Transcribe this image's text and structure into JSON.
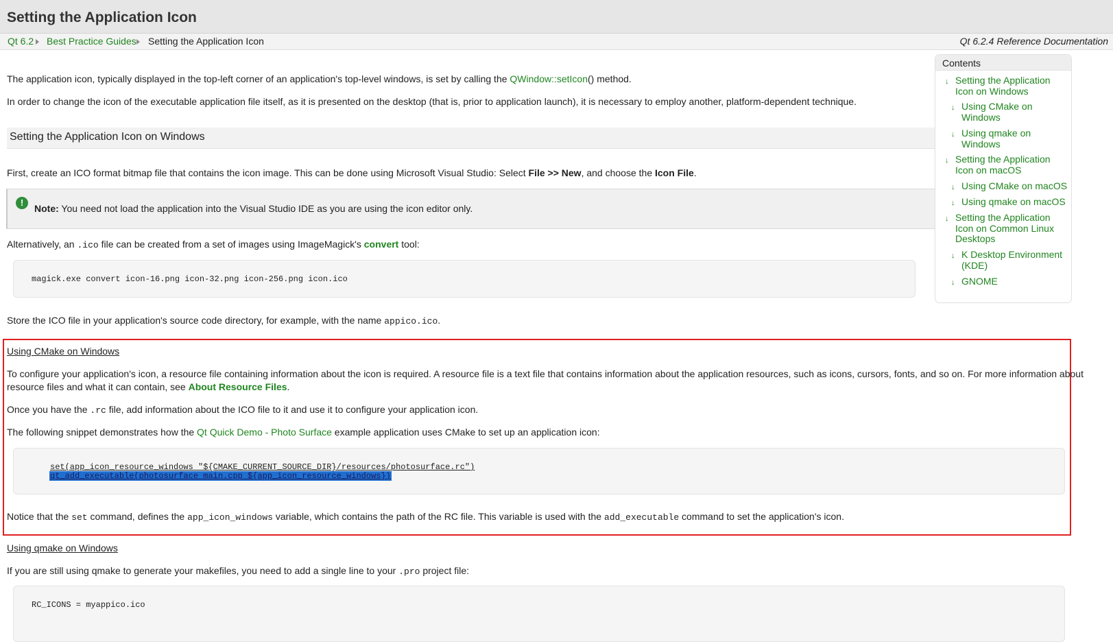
{
  "header": {
    "title": "Setting the Application Icon"
  },
  "breadcrumb": {
    "items": [
      "Qt 6.2",
      "Best Practice Guides"
    ],
    "current": "Setting the Application Icon",
    "ref": "Qt 6.2.4 Reference Documentation"
  },
  "intro": {
    "p1_before": "The application icon, typically displayed in the top-left corner of an application's top-level windows, is set by calling the ",
    "p1_link": "QWindow::setIcon",
    "p1_after": "() method.",
    "p2": "In order to change the icon of the executable application file itself, as it is presented on the desktop (that is, prior to application launch), it is necessary to employ another, platform-dependent technique."
  },
  "section_windows": {
    "heading": "Setting the Application Icon on Windows",
    "p1_before": "First, create an ICO format bitmap file that contains the icon image. This can be done using Microsoft Visual Studio: Select ",
    "p1_bold1": "File >> New",
    "p1_mid": ", and choose the ",
    "p1_bold2": "Icon File",
    "p1_after": ".",
    "note_label": "Note:",
    "note_text": " You need not load the application into the Visual Studio IDE as you are using the icon editor only.",
    "alt_before": "Alternatively, an ",
    "alt_code": ".ico",
    "alt_mid": " file can be created from a set of images using ImageMagick's ",
    "alt_link": "convert",
    "alt_after": " tool:",
    "code1": "magick.exe convert icon-16.png icon-32.png icon-256.png icon.ico",
    "store_before": "Store the ICO file in your application's source code directory, for example, with the name ",
    "store_code": "appico.ico",
    "store_after": "."
  },
  "cmake": {
    "heading": "Using CMake on Windows",
    "p1": "To configure your application's icon, a resource file containing information about the icon is required. A resource file is a text file that contains information about the application resources, such as icons, cursors, fonts, and so on. For more information about",
    "p1b_before": "resource files and what it can contain, see ",
    "p1b_link": "About Resource Files",
    "p1b_after": ".",
    "p2_before": "Once you have the ",
    "p2_code": ".rc",
    "p2_after": " file, add information about the ICO file to it and use it to configure your application icon.",
    "p3_before": "The following snippet demonstrates how the ",
    "p3_link": "Qt Quick Demo - Photo Surface",
    "p3_after": " example application uses CMake to set up an application icon:",
    "code_line1": "set(app_icon_resource_windows \"${CMAKE_CURRENT_SOURCE_DIR}/resources/photosurface.rc\")",
    "code_line2": "qt_add_executable(photosurface main.cpp ${app_icon_resource_windows})",
    "p4_before": "Notice that the ",
    "p4_code1": "set",
    "p4_mid1": " command, defines the ",
    "p4_code2": "app_icon_windows",
    "p4_mid2": " variable, which contains the path of the RC file. This variable is used with the ",
    "p4_code3": "add_executable",
    "p4_after": " command to set the application's icon."
  },
  "qmake": {
    "heading": "Using qmake on Windows",
    "p1_before": "If you are still using qmake to generate your makefiles, you need to add a single line to your ",
    "p1_code": ".pro",
    "p1_after": " project file:",
    "code": "RC_ICONS = myappico.ico"
  },
  "toc": {
    "title": "Contents",
    "items": [
      "Setting the Application Icon on Windows",
      "Using CMake on Windows",
      "Using qmake on Windows",
      "Setting the Application Icon on macOS",
      "Using CMake on macOS",
      "Using qmake on macOS",
      "Setting the Application Icon on Common Linux Desktops",
      "K Desktop Environment (KDE)",
      "GNOME"
    ]
  },
  "colors": {
    "link": "#208520",
    "highlight_border": "#e02020",
    "selection": "#1f6fd1"
  }
}
